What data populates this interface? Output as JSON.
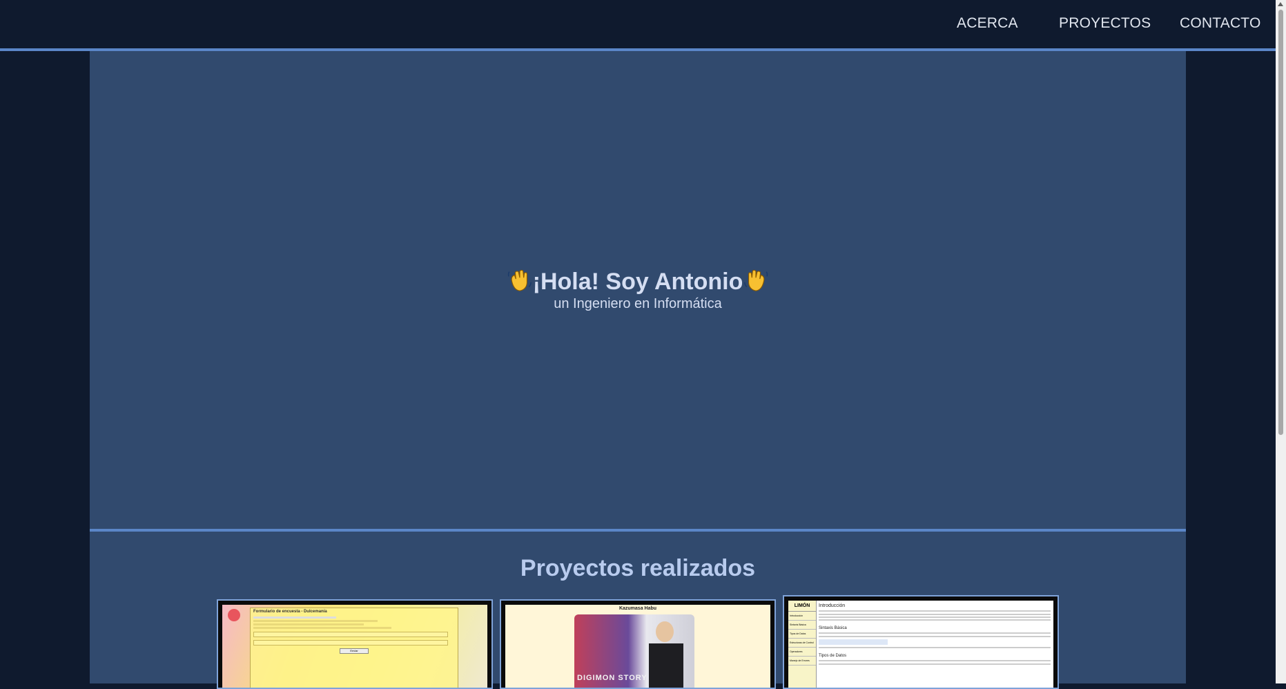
{
  "nav": {
    "items": [
      {
        "label": "ACERCA"
      },
      {
        "label": "PROYECTOS"
      },
      {
        "label": "CONTACTO"
      }
    ]
  },
  "hero": {
    "title": "¡Hola! Soy Antonio",
    "subtitle": "un Ingeniero en Informática",
    "icon_left": "waving-hand-icon",
    "icon_right": "waving-hand-icon"
  },
  "projects": {
    "title": "Proyectos realizados",
    "cards": [
      {
        "thumb_title": "Formulario de encuesta - Dulcemanía",
        "thumb_button": "Enviar"
      },
      {
        "thumb_title": "Kazumasa Habu",
        "thumb_banner": "DIGIMON STORY"
      },
      {
        "thumb_logo": "LIMÓN",
        "thumb_menu": [
          "Introducción",
          "Sintaxis Básica",
          "Tipos de Datos",
          "Estructuras de Control",
          "Operadores",
          "Manejo de Errores"
        ],
        "thumb_headings": [
          "Introducción",
          "Sintaxis Básica",
          "Tipos de Datos"
        ]
      }
    ]
  },
  "colors": {
    "background": "#0f1a2e",
    "panel": "#314a6e",
    "accent": "#5b86c8",
    "title_text": "#d5def2"
  }
}
